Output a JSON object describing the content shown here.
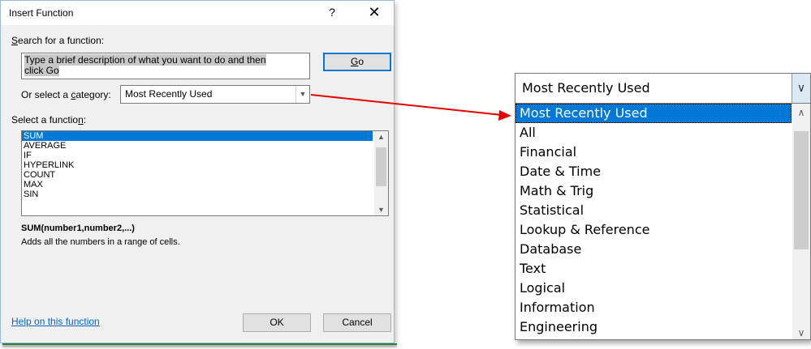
{
  "dialog": {
    "title": "Insert Function",
    "help_glyph": "?",
    "close_glyph": "✕",
    "search_label_first": "S",
    "search_label_rest": "earch for a function:",
    "search_value_line1": "Type a brief description of what you want to do and then",
    "search_value_line2": "click Go",
    "go_label_first": "G",
    "go_label_rest": "o",
    "category_label_pre": "Or select a ",
    "category_label_u": "c",
    "category_label_post": "ategory:",
    "category_value": "Most Recently Used",
    "function_label_pre": "Select a functio",
    "function_label_u": "n",
    "function_label_post": ":",
    "functions": [
      "SUM",
      "AVERAGE",
      "IF",
      "HYPERLINK",
      "COUNT",
      "MAX",
      "SIN"
    ],
    "selected_function": "SUM",
    "syntax": "SUM(number1,number2,...)",
    "description": "Adds all the numbers in a range of cells.",
    "help_link": "Help on this function",
    "ok_label": "OK",
    "cancel_label": "Cancel"
  },
  "zoom": {
    "combo_value": "Most Recently Used",
    "options": [
      "Most Recently Used",
      "All",
      "Financial",
      "Date & Time",
      "Math & Trig",
      "Statistical",
      "Lookup & Reference",
      "Database",
      "Text",
      "Logical",
      "Information",
      "Engineering"
    ],
    "selected_option": "Most Recently Used"
  },
  "colors": {
    "selection": "#0078d7",
    "arrow": "#e60000",
    "link": "#0066cc"
  },
  "icons": {
    "dropdown": "chevron-down-icon",
    "scroll_up": "chevron-up-icon",
    "scroll_down": "chevron-down-icon"
  }
}
